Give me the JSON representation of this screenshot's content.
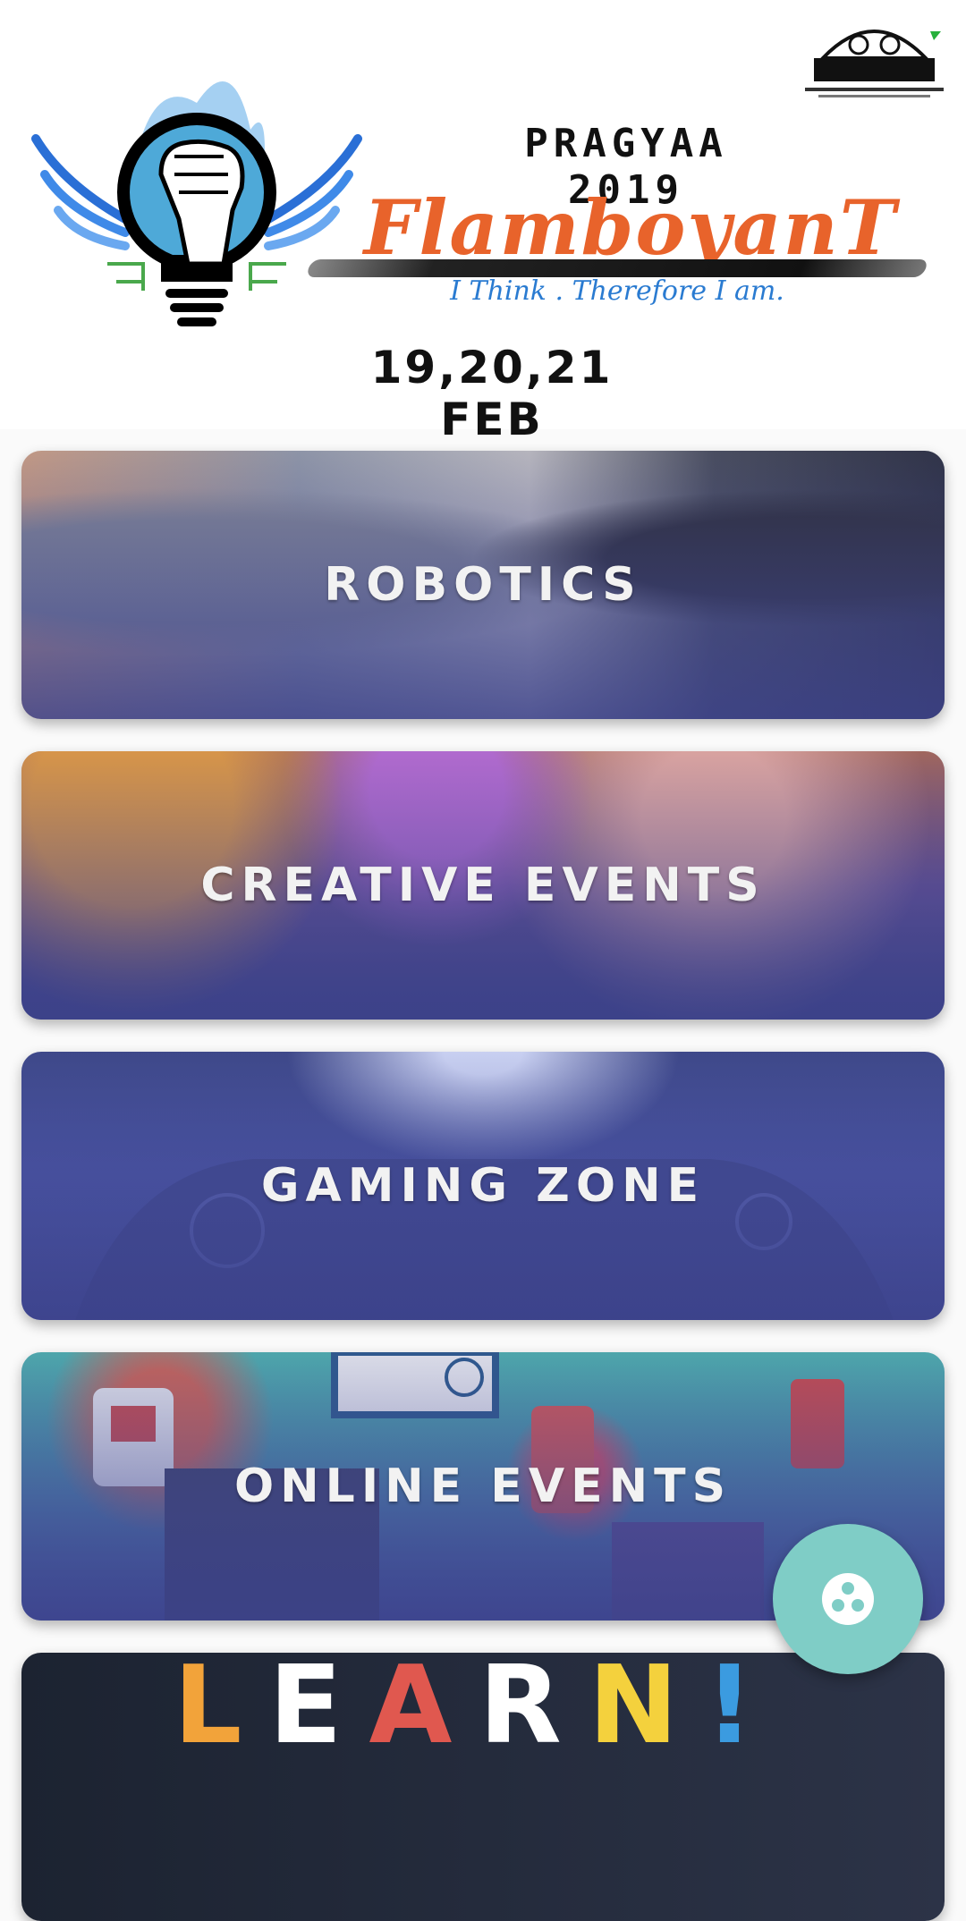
{
  "banner": {
    "college_logo": "college-emblem",
    "fest_logo": "fist-lightbulb-wings",
    "fest_year": "PRAGYAA\n2019",
    "fest_name": "FlamboyanT",
    "tagline": "I Think . Therefore I am.",
    "dates": "19,20,21 FEB"
  },
  "events": [
    {
      "title": "ROBOTICS"
    },
    {
      "title": "CREATIVE EVENTS"
    },
    {
      "title": "GAMING ZONE"
    },
    {
      "title": "ONLINE EVENTS"
    },
    {
      "title": ""
    }
  ],
  "fab": {
    "icon": "three-dots-circle-icon"
  },
  "colors": {
    "fab": "#7fcdc6",
    "card_overlay": "#4a55a2"
  }
}
